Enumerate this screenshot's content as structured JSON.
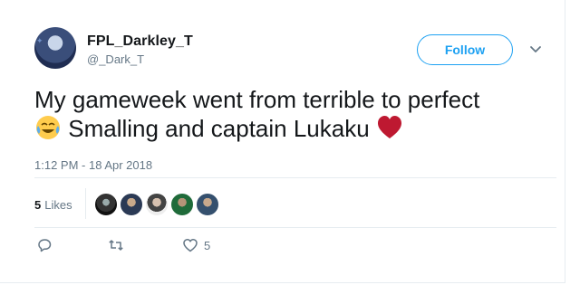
{
  "author": {
    "display_name": "FPL_Darkley_T",
    "handle": "@_Dark_T"
  },
  "follow_label": "Follow",
  "tweet": {
    "line1": "My gameweek went from terrible to perfect",
    "line2": "Smalling and captain Lukaku",
    "emojis": [
      "face-with-tears-of-joy-icon",
      "red-heart-icon"
    ]
  },
  "timestamp": "1:12 PM - 18 Apr 2018",
  "likes": {
    "count": "5",
    "label": "Likes",
    "liker_avatars": 5
  },
  "actions": {
    "reply_count": "",
    "retweet_count": "",
    "like_count": "5"
  },
  "colors": {
    "accent": "#1da1f2",
    "heart": "#e0245e",
    "secondary_text": "#657786"
  }
}
